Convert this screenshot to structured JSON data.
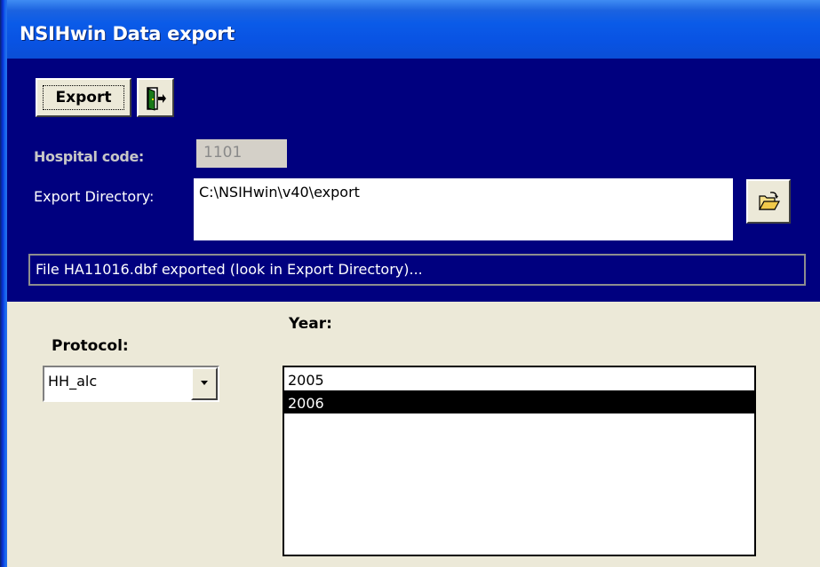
{
  "window": {
    "title": "NSIHwin Data export"
  },
  "toolbar": {
    "export_label": "Export"
  },
  "hospital": {
    "label": "Hospital code:",
    "value": "1101"
  },
  "export_dir": {
    "label": "Export Directory:",
    "value": "C:\\NSIHwin\\v40\\export"
  },
  "status": {
    "message": "File HA11016.dbf exported (look in Export Directory)..."
  },
  "protocol": {
    "label": "Protocol:",
    "selected": "HH_alc"
  },
  "year": {
    "label": "Year:",
    "items": [
      {
        "label": "2005",
        "selected": false
      },
      {
        "label": "2006",
        "selected": true
      }
    ]
  },
  "colors": {
    "titlebar": "#0a5be8",
    "header_panel": "#00007f",
    "body": "#ece9d8",
    "selection": "#000000"
  },
  "icons": [
    "exit-door-icon",
    "open-folder-icon",
    "dropdown-arrow-icon"
  ]
}
